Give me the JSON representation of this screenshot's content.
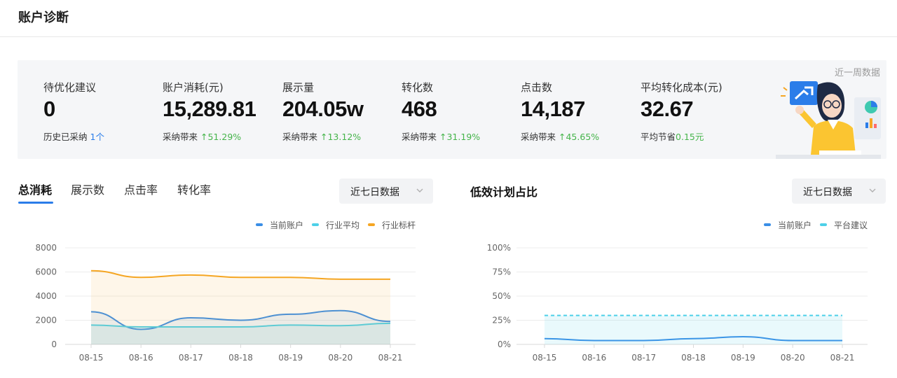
{
  "header": {
    "title": "账户诊断"
  },
  "summary": {
    "period_label": "近一周数据",
    "metrics": [
      {
        "label": "待优化建议",
        "value": "0",
        "sub_text": "历史已采纳",
        "sub_value": "1个",
        "sub_color": "blue"
      },
      {
        "label": "账户消耗(元)",
        "value": "15,289.81",
        "sub_text": "采纳带来",
        "sub_value": "51.29%",
        "sub_color": "green"
      },
      {
        "label": "展示量",
        "value": "204.05w",
        "sub_text": "采纳带来",
        "sub_value": "13.12%",
        "sub_color": "green"
      },
      {
        "label": "转化数",
        "value": "468",
        "sub_text": "采纳带来",
        "sub_value": "31.19%",
        "sub_color": "green"
      },
      {
        "label": "点击数",
        "value": "14,187",
        "sub_text": "采纳带来",
        "sub_value": "45.65%",
        "sub_color": "green"
      },
      {
        "label": "平均转化成本(元)",
        "value": "32.67",
        "sub_text": "平均节省",
        "sub_value": "0.15元",
        "sub_color": "green"
      }
    ]
  },
  "left_panel": {
    "tabs": [
      {
        "label": "总消耗",
        "active": true
      },
      {
        "label": "展示数",
        "active": false
      },
      {
        "label": "点击率",
        "active": false
      },
      {
        "label": "转化率",
        "active": false
      }
    ],
    "select_value": "近七日数据"
  },
  "right_panel": {
    "title": "低效计划占比",
    "select_value": "近七日数据"
  },
  "colors": {
    "current": "#3a8ee6",
    "industry_avg": "#4dd0e8",
    "benchmark": "#f5a623",
    "up_green": "#45b44a",
    "accent_blue": "#2b7de9"
  },
  "chart_data": [
    {
      "type": "area",
      "categories": [
        "08-15",
        "08-16",
        "08-17",
        "08-18",
        "08-19",
        "08-20",
        "08-21"
      ],
      "ylim": [
        0,
        8000
      ],
      "yticks": [
        "0",
        "2000",
        "4000",
        "6000",
        "8000"
      ],
      "grid": true,
      "legend_position": "top-right",
      "series": [
        {
          "name": "当前账户",
          "values": [
            2700,
            1250,
            2200,
            2000,
            2500,
            2800,
            1900
          ]
        },
        {
          "name": "行业平均",
          "values": [
            1600,
            1450,
            1450,
            1450,
            1600,
            1550,
            1750
          ]
        },
        {
          "name": "行业标杆",
          "values": [
            6100,
            5550,
            5750,
            5550,
            5550,
            5400,
            5400
          ]
        }
      ]
    },
    {
      "type": "line",
      "categories": [
        "08-15",
        "08-16",
        "08-17",
        "08-18",
        "08-19",
        "08-20",
        "08-21"
      ],
      "ylim": [
        0,
        100
      ],
      "yticks": [
        "0%",
        "25%",
        "50%",
        "75%",
        "100%"
      ],
      "grid": true,
      "legend_position": "top-right",
      "series": [
        {
          "name": "当前账户",
          "values": [
            6,
            4,
            4,
            6,
            8,
            4,
            4
          ]
        },
        {
          "name": "平台建议",
          "values": [
            30,
            30,
            30,
            30,
            30,
            30,
            30
          ]
        }
      ]
    }
  ]
}
